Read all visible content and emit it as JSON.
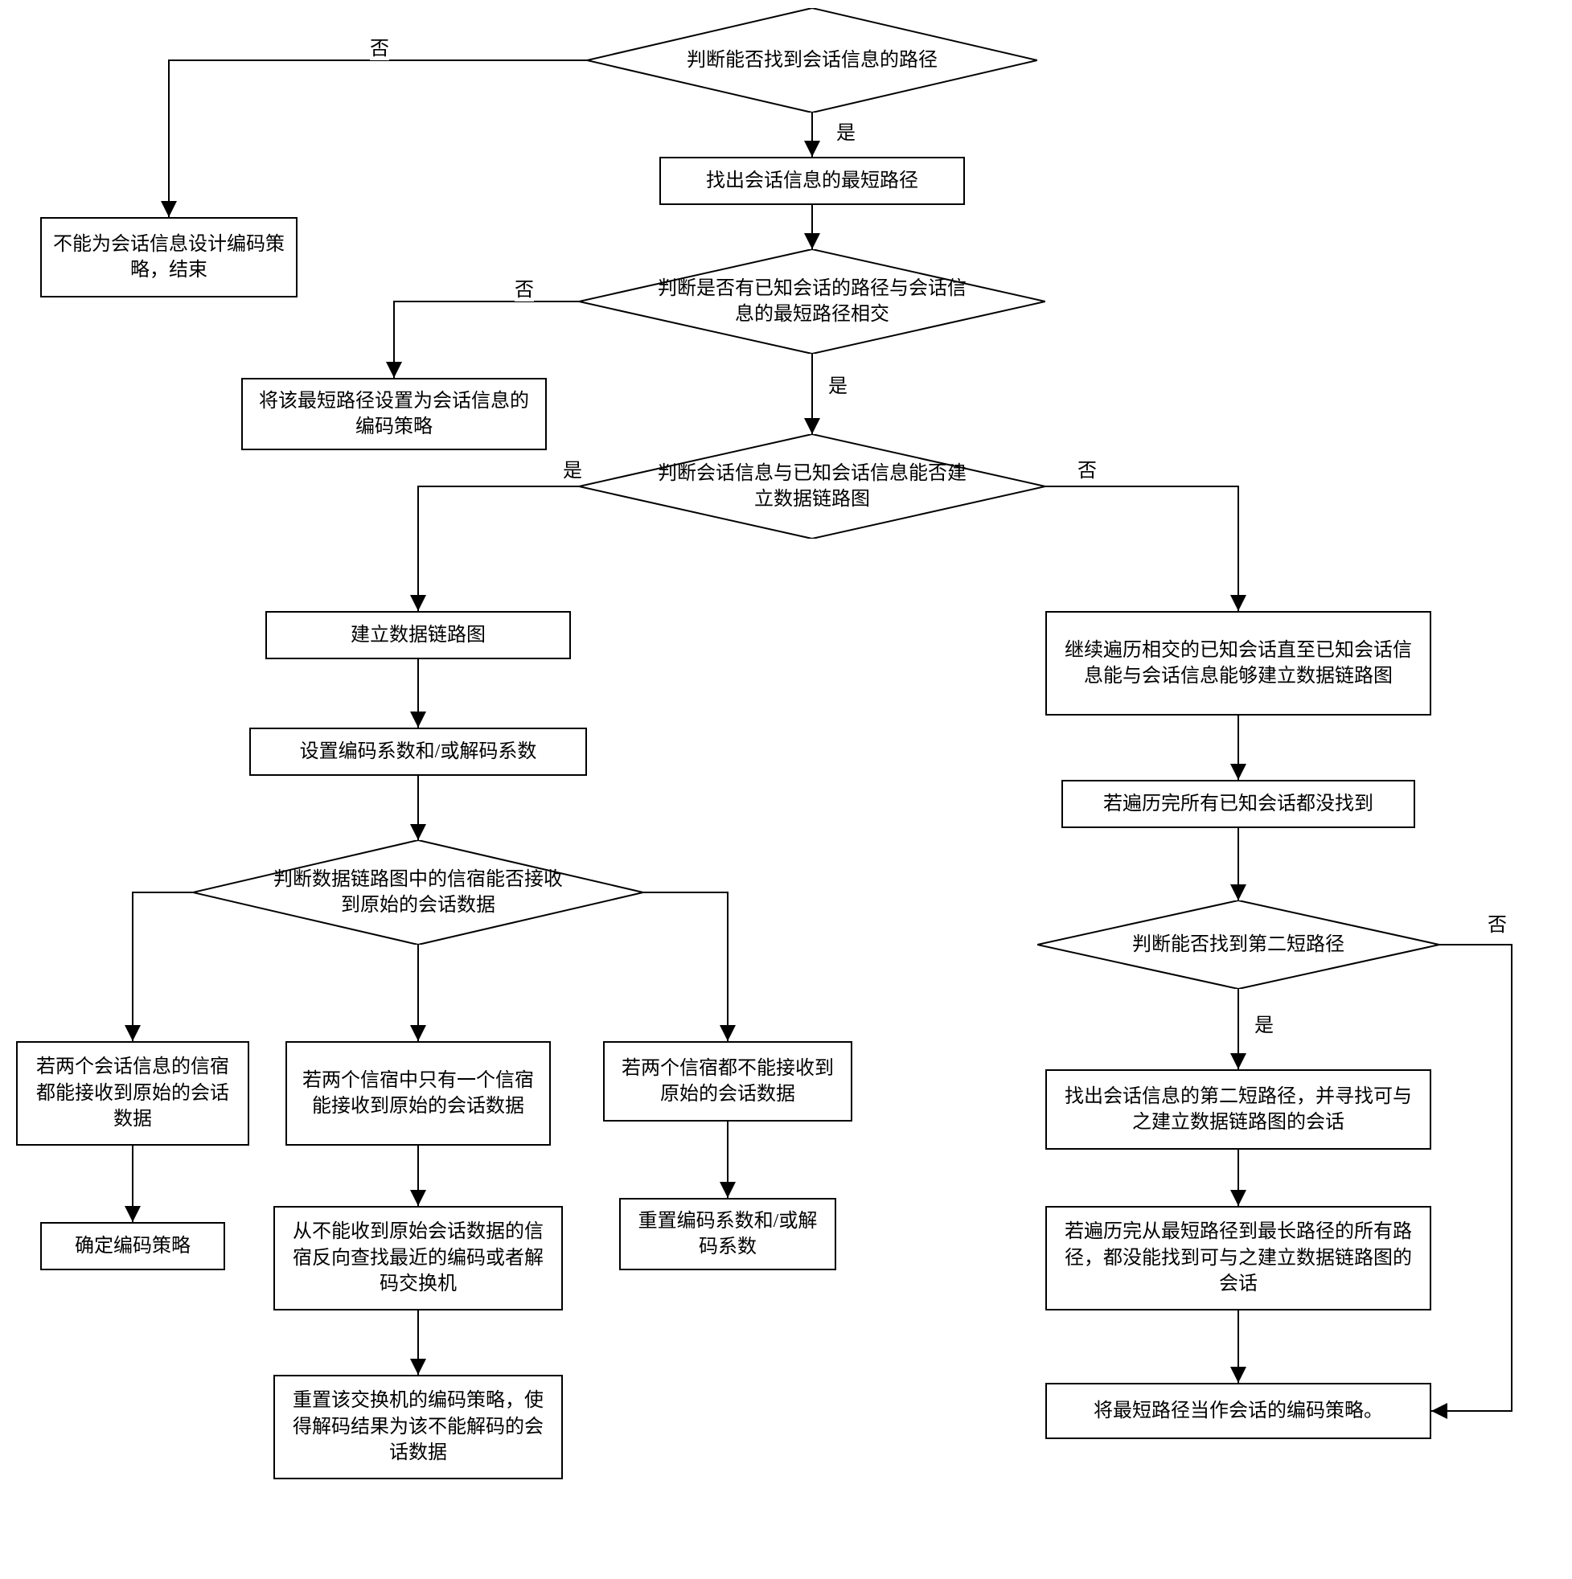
{
  "labels": {
    "yes": "是",
    "no": "否"
  },
  "nodes": {
    "d1": "判断能否找到会话信息的路径",
    "b_end": "不能为会话信息设计编码策略，结束",
    "b_shortest": "找出会话信息的最短路径",
    "d2": "判断是否有已知会话的路径与会话信息的最短路径相交",
    "b_set_strategy": "将该最短路径设置为会话信息的编码策略",
    "d3": "判断会话信息与已知会话信息能否建立数据链路图",
    "b_build_graph": "建立数据链路图",
    "b_set_coeff": "设置编码系数和/或解码系数",
    "d4": "判断数据链路图中的信宿能否接收到原始的会话数据",
    "b_both_recv": "若两个会话信息的信宿都能接收到原始的会话数据",
    "b_confirm": "确定编码策略",
    "b_one_recv": "若两个信宿中只有一个信宿能接收到原始的会话数据",
    "b_reverse_find": "从不能收到原始会话数据的信宿反向查找最近的编码或者解码交换机",
    "b_reset_switch": "重置该交换机的编码策略，使得解码结果为该不能解码的会话数据",
    "b_none_recv": "若两个信宿都不能接收到原始的会话数据",
    "b_reset_coeff": "重置编码系数和/或解码系数",
    "b_traverse": "继续遍历相交的已知会话直至已知会话信息能与会话信息能够建立数据链路图",
    "b_not_found": "若遍历完所有已知会话都没找到",
    "d5": "判断能否找到第二短路径",
    "b_second_path": "找出会话信息的第二短路径，并寻找可与之建立数据链路图的会话",
    "b_all_traversed": "若遍历完从最短路径到最长路径的所有路径，都没能找到可与之建立数据链路图的会话",
    "b_use_shortest": "将最短路径当作会话的编码策略。"
  }
}
